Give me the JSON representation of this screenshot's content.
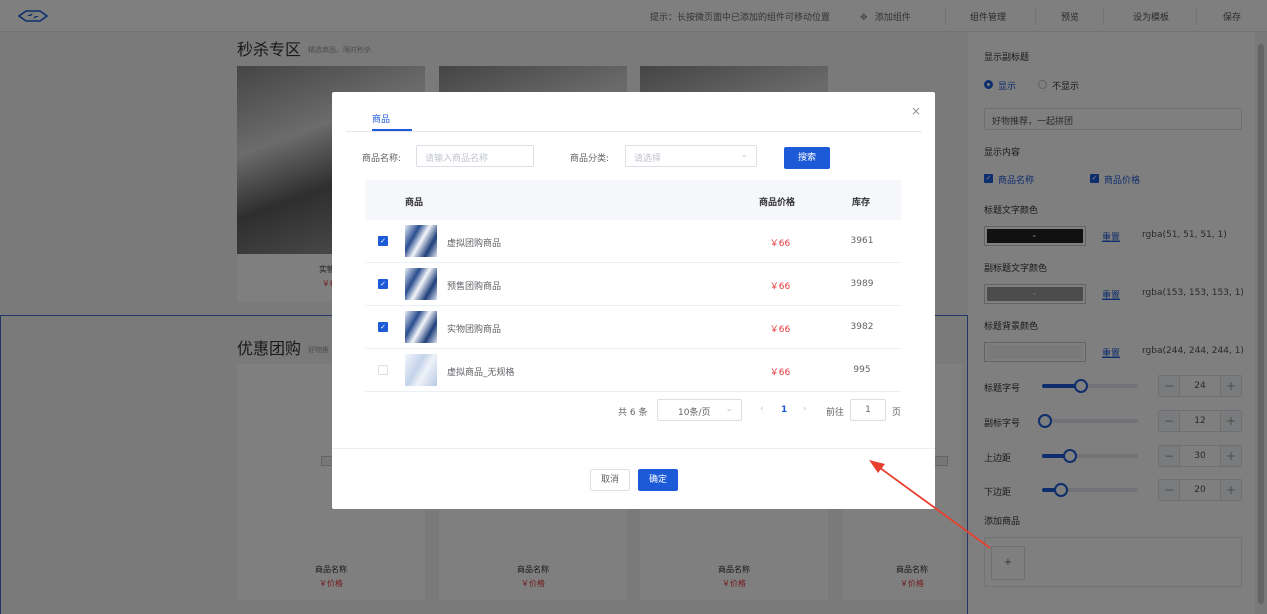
{
  "topbar": {
    "hint": "提示：长按微页面中已添加的组件可移动位置",
    "add_component": "添加组件",
    "buttons": [
      "组件管理",
      "预览",
      "设为模板",
      "保存"
    ]
  },
  "canvas": {
    "flash_title": "秒杀专区",
    "flash_sub": "精选商品、限时秒杀",
    "flash_card_name": "实物秒",
    "flash_card_price": "￥66",
    "group_title": "优惠团购",
    "group_sub": "好物推",
    "group_cards": [
      {
        "name": "商品名称",
        "price": "￥价格"
      },
      {
        "name": "商品名称",
        "price": "￥价格"
      },
      {
        "name": "商品名称",
        "price": "￥价格"
      },
      {
        "name": "商品名称",
        "price": "￥价格"
      }
    ]
  },
  "settings": {
    "show_subtitle_label": "显示副标题",
    "radio_show": "显示",
    "radio_hide": "不显示",
    "subtitle_value": "好物推荐，一起拼团",
    "content_label": "显示内容",
    "chk_name": "商品名称",
    "chk_price": "商品价格",
    "title_color_label": "标题文字颜色",
    "subtitle_color_label": "副标题文字颜色",
    "title_bg_label": "标题背景颜色",
    "reset": "重置",
    "title_color": "rgba(51, 51, 51, 1)",
    "subtitle_color": "rgba(153, 153, 153, 1)",
    "bg_color": "rgba(244, 244, 244, 1)",
    "title_size_label": "标题字号",
    "subtitle_size_label": "副标字号",
    "top_margin_label": "上边距",
    "bottom_margin_label": "下边距",
    "title_size": "24",
    "subtitle_size": "12",
    "top_margin": "30",
    "bottom_margin": "20",
    "add_goods_label": "添加商品",
    "add_goods_btn": "+"
  },
  "dialog": {
    "tab": "商品",
    "name_label": "商品名称:",
    "name_placeholder": "请输入商品名称",
    "category_label": "商品分类:",
    "category_placeholder": "请选择",
    "search_btn": "搜索",
    "columns": {
      "product": "商品",
      "price": "商品价格",
      "stock": "库存"
    },
    "rows": [
      {
        "name": "虚拟团购商品",
        "price": "￥66",
        "stock": "3961",
        "checked": true
      },
      {
        "name": "预售团购商品",
        "price": "￥66",
        "stock": "3989",
        "checked": true
      },
      {
        "name": "实物团购商品",
        "price": "￥66",
        "stock": "3982",
        "checked": true
      },
      {
        "name": "虚拟商品_无规格",
        "price": "￥66",
        "stock": "995",
        "checked": false
      }
    ],
    "pager": {
      "total": "共 6 条",
      "page_size": "10条/页",
      "current": "1",
      "goto_label": "前往",
      "goto_value": "1",
      "page_suffix": "页"
    },
    "cancel": "取消",
    "ok": "确定"
  },
  "colors": {
    "accent": "#1d5ad8",
    "price_red": "#e4393c",
    "annotation_arrow": "#e8402f"
  }
}
